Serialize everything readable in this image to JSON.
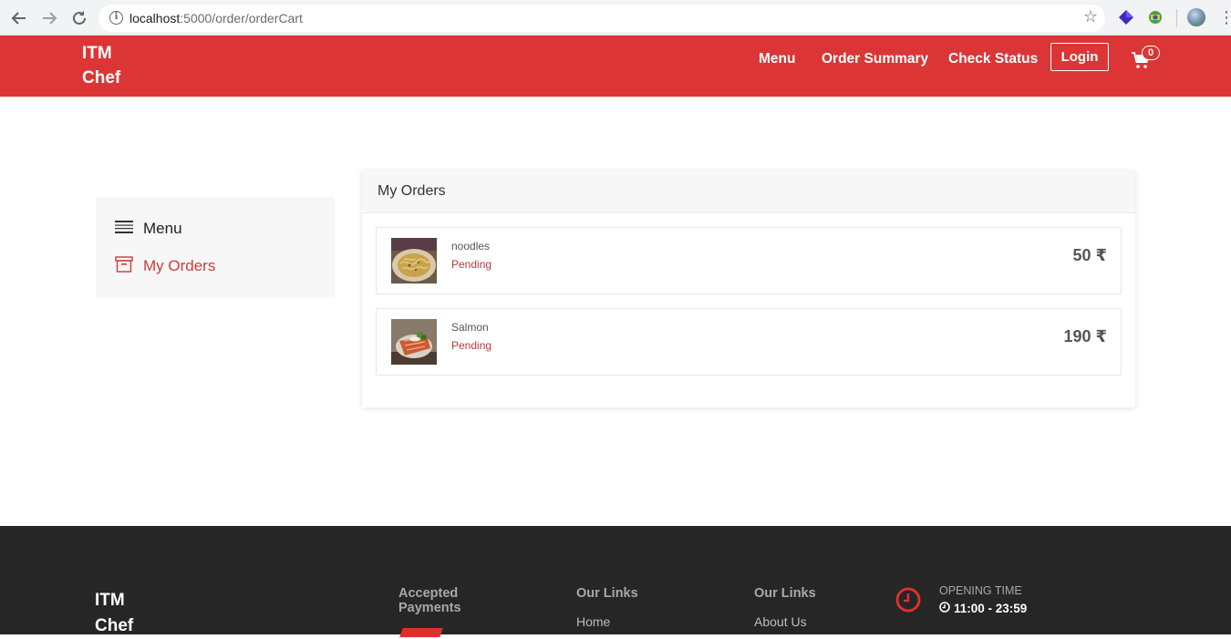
{
  "browser": {
    "url_host": "localhost",
    "url_path": ":5000/order/orderCart"
  },
  "header": {
    "brand_line1": "ITM",
    "brand_line2": "Chef",
    "nav": {
      "menu": "Menu",
      "order_summary": "Order Summary",
      "check_status": "Check Status"
    },
    "login_label": "Login",
    "cart_count": "0"
  },
  "sidebar": {
    "items": [
      {
        "label": "Menu",
        "icon": "list-icon",
        "active": false
      },
      {
        "label": "My Orders",
        "icon": "archive-box-icon",
        "active": true
      }
    ]
  },
  "orders": {
    "title": "My Orders",
    "items": [
      {
        "name": "noodles",
        "status": "Pending",
        "price": "50 ₹",
        "image": "noodles-photo"
      },
      {
        "name": "Salmon",
        "status": "Pending",
        "price": "190 ₹",
        "image": "salmon-photo"
      }
    ]
  },
  "footer": {
    "brand_line1": "ITM",
    "brand_line2": "Chef",
    "payments_heading_line1": "Accepted",
    "payments_heading_line2": "Payments",
    "links_heading_1": "Our Links",
    "links_heading_2": "Our Links",
    "link_home": "Home",
    "link_about": "About Us",
    "opening_label": "OPENING TIME",
    "opening_hours": "11:00 - 23:59"
  },
  "colors": {
    "brand_red": "#dc3535",
    "footer_bg": "#262626",
    "status_red": "#b43c3c"
  }
}
